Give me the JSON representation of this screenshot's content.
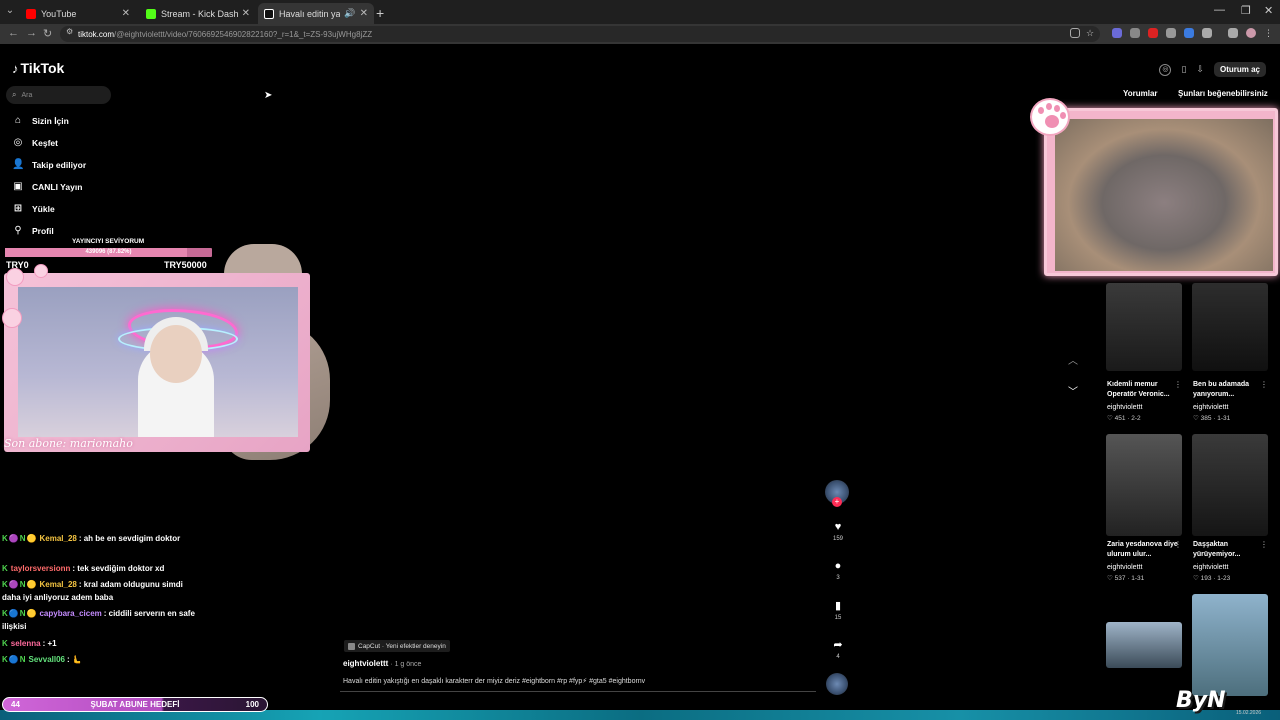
{
  "browser": {
    "tabs": [
      {
        "label": "YouTube",
        "color": "#ff0000"
      },
      {
        "label": "Stream - Kick Dashboard",
        "color": "#53fc18"
      },
      {
        "label": "Havalı editin yakıştığı en da",
        "color": "#ffffff"
      }
    ],
    "url_host": "tiktok.com",
    "url_path": "/@eightviolettt/video/7606692546902822160?_r=1&_t=ZS-93ujWHg8jZZ"
  },
  "tiktok": {
    "logo": "TikTok",
    "search_placeholder": "Ara",
    "nav": [
      {
        "label": "Sizin İçin",
        "icon": "home-icon"
      },
      {
        "label": "Keşfet",
        "icon": "compass-icon"
      },
      {
        "label": "Takip ediliyor",
        "icon": "following-icon"
      },
      {
        "label": "CANLI Yayın",
        "icon": "live-icon"
      },
      {
        "label": "Yükle",
        "icon": "upload-icon"
      },
      {
        "label": "Profil",
        "icon": "profile-icon"
      }
    ],
    "login_label": "Oturum aç",
    "panel_tabs": {
      "comments": "Yorumlar",
      "suggested": "Şunları beğenebilirsiniz"
    },
    "suggested": [
      {
        "title": "Kıdemli memur Operatör Veronic...",
        "author": "eightviolettt",
        "stats": "451 · 2-2"
      },
      {
        "title": "Ben bu adamada yanıyorum...",
        "author": "eightviolettt",
        "stats": "385 · 1-31"
      },
      {
        "title": "Zaria yesdanova diye ulurum ulur...",
        "author": "eightviolettt",
        "stats": "537 · 1-31"
      },
      {
        "title": "Daşşaktan yürüyemiyor...",
        "author": "eightviolettt",
        "stats": "193 · 1-23"
      }
    ],
    "video": {
      "capcut": "CapCut · Yeni efektler deneyin",
      "author": "eightviolettt",
      "time": " · 1 g önce",
      "description": "Havalı editin yakıştığı en daşaklı karakterr der miyiz deriz #eightborn #rp #fyp⚡ #gta5 #eightbornv",
      "likes": "159",
      "comments": "3",
      "saves": "15",
      "shares": "4"
    }
  },
  "overlay": {
    "goal_title": "YAYINCIYI SEVİYORUM",
    "goal_progress_text": "439096 (87.82%)",
    "goal_fraction": 0.8782,
    "goal_min": "TRY0",
    "goal_max": "TRY50000",
    "last_sub": "Son abone: mariomaho",
    "chat": [
      {
        "badges": "K🟣N🟡",
        "user": "Kemal_28",
        "user_color": "#f5c542",
        "message": ": ah be en sevdigim doktor"
      },
      {
        "badges": "K",
        "user": "taylorsversionn",
        "user_color": "#ff6b6b",
        "message": ": tek sevdiğim doktor xd"
      },
      {
        "badges": "K🟣N🟡",
        "user": "Kemal_28",
        "user_color": "#f5c542",
        "message": ": kral adam oldugunu simdi daha iyi anliyoruz adem baba"
      },
      {
        "badges": "K🔵N🟡",
        "user": "capybara_cicem",
        "user_color": "#c58cff",
        "message": ": ciddili serverın en safe ilişkisi"
      },
      {
        "badges": "K",
        "user": "selenna",
        "user_color": "#ff6b9d",
        "message": ": +1"
      },
      {
        "badges": "K🔵N",
        "user": "Sevvall06",
        "user_color": "#63e27c",
        "message": ": 🫷"
      }
    ],
    "sub_goal": {
      "current": "44",
      "title": "ŞUBAT ABUNE HEDEFİ",
      "target": "100"
    },
    "watermark": "ByN",
    "watermark_date": "15.02.2026"
  }
}
